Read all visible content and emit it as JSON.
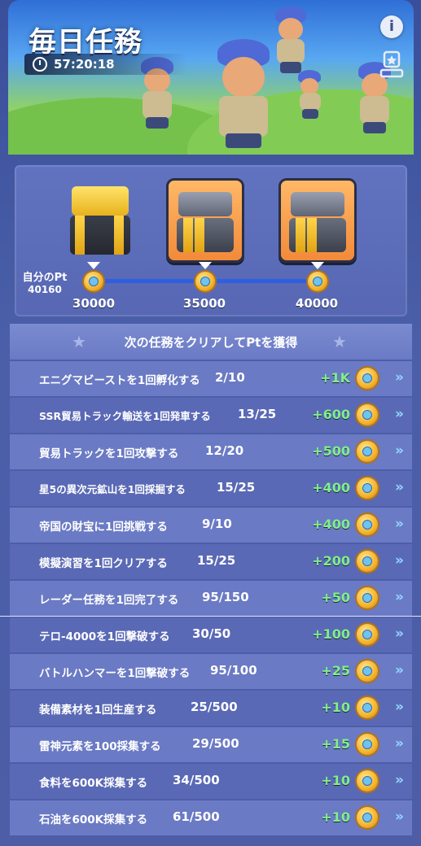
{
  "header": {
    "title": "毎日任務",
    "timer": "57:20:18",
    "info_icon": "info-icon",
    "trophy_icon": "trophy-icon"
  },
  "rewards": {
    "own_pt_label": "自分のPt",
    "own_pt_value": "40160",
    "tiers": [
      {
        "points": "30000",
        "chest": "gold-chest-icon"
      },
      {
        "points": "35000",
        "chest": "steel-chest-icon"
      },
      {
        "points": "40000",
        "chest": "steel-chest-icon"
      }
    ]
  },
  "list": {
    "header": "次の任務をクリアしてPtを獲得",
    "tasks": [
      {
        "name": "エニグマビーストを1回孵化する",
        "progress": "2/10",
        "points": "+1K"
      },
      {
        "name": "SSR貿易トラック輸送を1回発車する",
        "progress": "13/25",
        "points": "+600"
      },
      {
        "name": "貿易トラックを1回攻撃する",
        "progress": "12/20",
        "points": "+500"
      },
      {
        "name": "星5の異次元鉱山を1回採掘する",
        "progress": "15/25",
        "points": "+400"
      },
      {
        "name": "帝国の財宝に1回挑戦する",
        "progress": "9/10",
        "points": "+400"
      },
      {
        "name": "模擬演習を1回クリアする",
        "progress": "15/25",
        "points": "+200"
      },
      {
        "name": "レーダー任務を1回完了する",
        "progress": "95/150",
        "points": "+50"
      },
      {
        "name": "テロ-4000を1回撃破する",
        "progress": "30/50",
        "points": "+100"
      },
      {
        "name": "バトルハンマーを1回撃破する",
        "progress": "95/100",
        "points": "+25"
      },
      {
        "name": "装備素材を1回生産する",
        "progress": "25/500",
        "points": "+10"
      },
      {
        "name": "雷神元素を100採集する",
        "progress": "29/500",
        "points": "+15"
      },
      {
        "name": "食料を600K採集する",
        "progress": "34/500",
        "points": "+10"
      },
      {
        "name": "石油を600K採集する",
        "progress": "61/500",
        "points": "+10"
      }
    ],
    "go_glyph": "»"
  },
  "colors": {
    "points_green": "#7ef08a",
    "panel_blue": "#5a69b5",
    "track_blue": "#2f5fe0"
  }
}
